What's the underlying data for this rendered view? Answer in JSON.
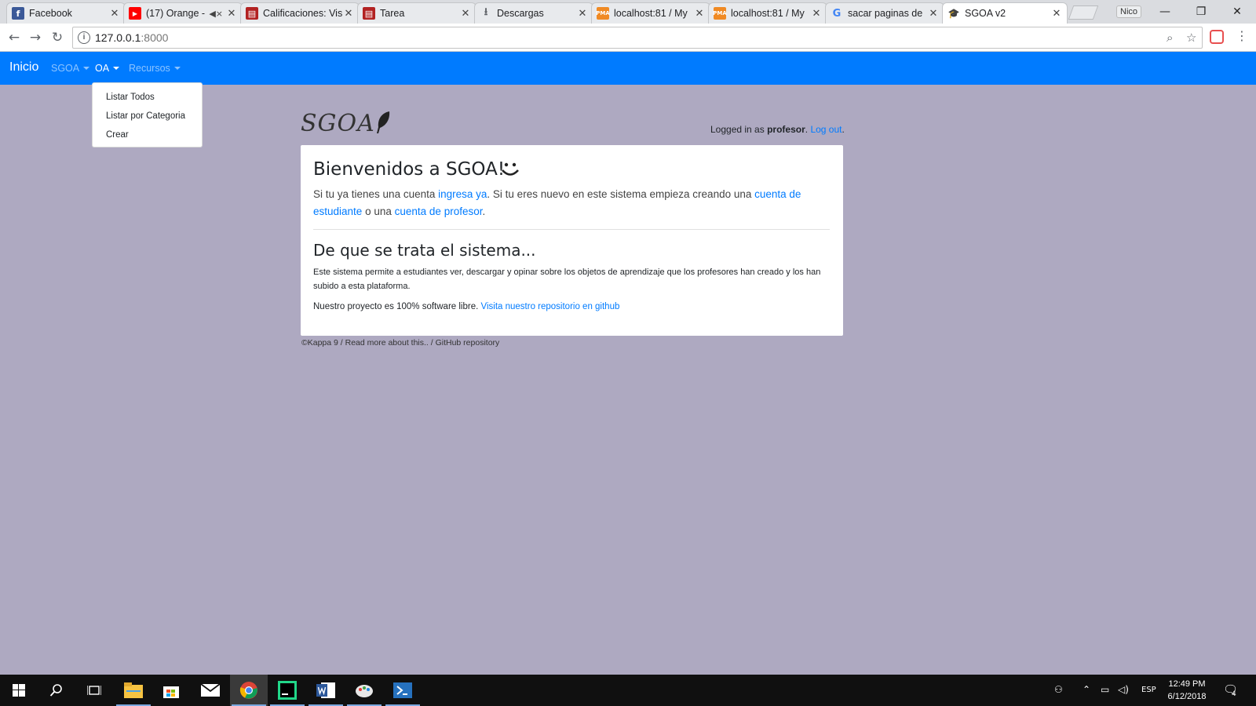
{
  "browser": {
    "tabs": [
      {
        "title": "Facebook",
        "icon": "facebook-icon",
        "color": "#3b5998"
      },
      {
        "title": "(17) Orange -",
        "icon": "youtube-icon",
        "color": "#ff0000",
        "muted": true
      },
      {
        "title": "Calificaciones: Vis",
        "icon": "uni-icon",
        "color": "#b22222"
      },
      {
        "title": "Tarea",
        "icon": "uni-icon",
        "color": "#b22222"
      },
      {
        "title": "Descargas",
        "icon": "download-icon",
        "color": "#5f6368"
      },
      {
        "title": "localhost:81 / My",
        "icon": "phpmyadmin-icon",
        "color": "#f08a24"
      },
      {
        "title": "localhost:81 / My",
        "icon": "phpmyadmin-icon",
        "color": "#f08a24"
      },
      {
        "title": "sacar paginas de",
        "icon": "google-icon",
        "color": "#4285f4"
      },
      {
        "title": "SGOA v2",
        "icon": "graduation-cap-icon",
        "color": "#202124"
      }
    ],
    "profile_name": "Nico",
    "url_host": "127.0.0.1",
    "url_port": ":8000"
  },
  "nav": {
    "brand": "Inicio",
    "items": [
      "SGOA",
      "OA",
      "Recursos"
    ],
    "dropdown": [
      "Listar Todos",
      "Listar por Categoria",
      "Crear"
    ]
  },
  "header": {
    "logo": "SGOA",
    "login_prefix": "Logged in as",
    "login_user": "profesor",
    "login_sep": ".",
    "logout": "Log out",
    "logout_tail": "."
  },
  "welcome": {
    "title": "Bienvenidos a SGOA!",
    "t1": "Si tu ya tienes una cuenta",
    "link1": "ingresa ya",
    "t2": ". Si tu eres nuevo en este sistema empieza creando una",
    "link2": "cuenta de estudiante",
    "t3": "o una",
    "link3": "cuenta de profesor",
    "t4": ".",
    "subtitle": "De que se trata el sistema...",
    "description": "Este sistema permite a estudiantes ver, descargar y opinar sobre los objetos de aprendizaje que los profesores han creado y los han subido a esta plataforma.",
    "oss_text": "Nuestro proyecto es 100% software libre.",
    "oss_link": "Visita nuestro repositorio en github"
  },
  "footer": {
    "text": "©Kappa 9 / Read more about this.. / GitHub repository"
  },
  "taskbar": {
    "language": "ESP",
    "time": "12:49 PM",
    "date": "6/12/2018",
    "notifications": "4"
  },
  "colors": {
    "page_bg": "#aea9c1",
    "navbar": "#007bff",
    "link": "#007bff"
  }
}
